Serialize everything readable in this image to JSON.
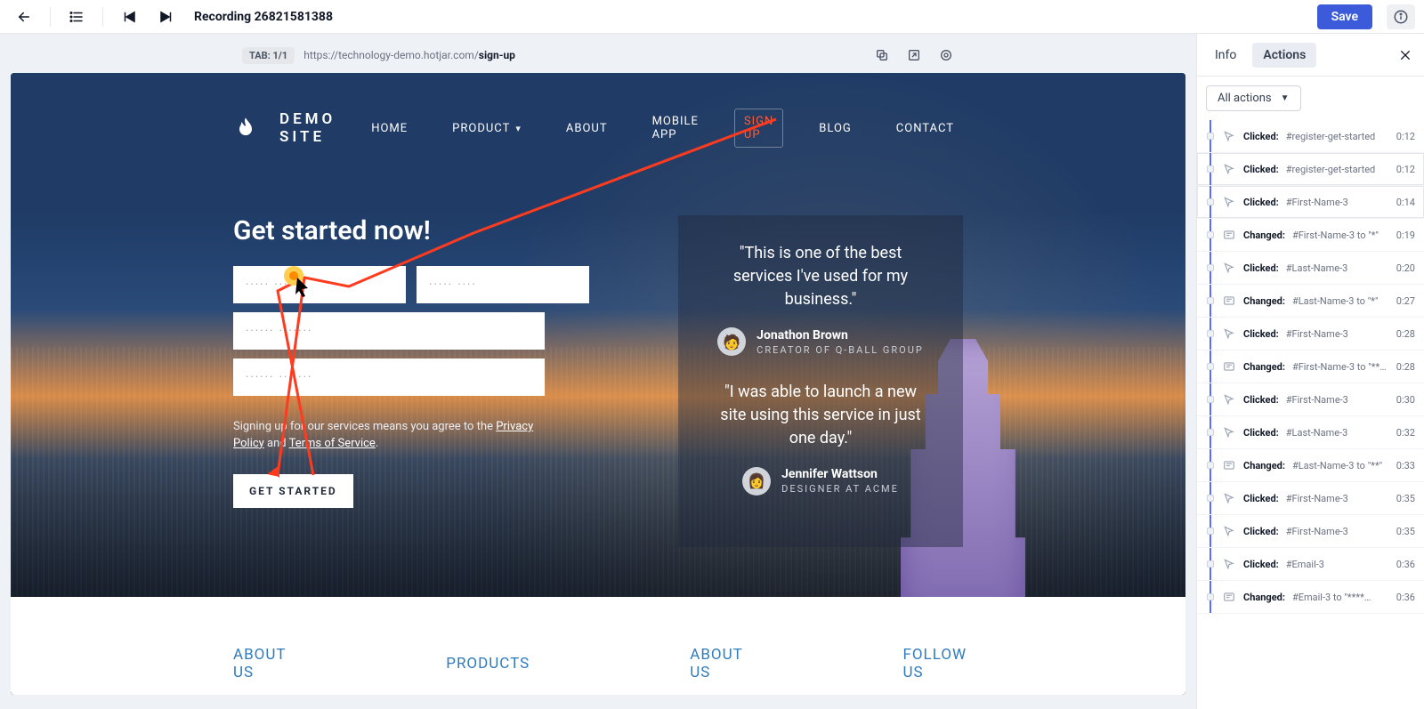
{
  "topbar": {
    "title": "Recording 26821581388",
    "save_label": "Save"
  },
  "urlbar": {
    "tab_pill": "TAB: 1/1",
    "url_dim": "https://technology-demo.hotjar.com/",
    "url_bold": "sign-up"
  },
  "site": {
    "brand": "DEMO SITE",
    "nav": {
      "home": "HOME",
      "product": "PRODUCT",
      "about": "ABOUT",
      "mobile": "MOBILE APP",
      "signup": "SIGN UP",
      "blog": "BLOG",
      "contact": "CONTACT"
    },
    "hero": {
      "headline": "Get started now!",
      "placeholders": {
        "first": "····· ····",
        "last": "····· ····",
        "email": "······ ·······",
        "password": "······ ·······"
      },
      "consent_prefix": "Signing up for our services means you agree to the ",
      "privacy": "Privacy Policy",
      "and": " and ",
      "tos": "Terms of Service",
      "period": ".",
      "cta": "GET STARTED"
    },
    "testimonials": [
      {
        "quote": "\"This is one of the best services I've used for my business.\"",
        "name": "Jonathon Brown",
        "role": "CREATOR OF Q-BALL GROUP"
      },
      {
        "quote": "\"I was able to launch a new site using this service in just one day.\"",
        "name": "Jennifer Wattson",
        "role": "DESIGNER AT ACME"
      }
    ],
    "footer": {
      "c1": "ABOUT US",
      "c2": "PRODUCTS",
      "c3": "ABOUT US",
      "c4": "FOLLOW US"
    }
  },
  "panel": {
    "tab_info": "Info",
    "tab_actions": "Actions",
    "filter_label": "All actions",
    "events": [
      {
        "type": "Clicked",
        "target": "#register-get-started",
        "ts": "0:12",
        "active": false
      },
      {
        "type": "Clicked",
        "target": "#register-get-started",
        "ts": "0:12",
        "active": true
      },
      {
        "type": "Clicked",
        "target": "#First-Name-3",
        "ts": "0:14",
        "active": true
      },
      {
        "type": "Changed",
        "target": "#First-Name-3&nbsp;to \"*\"",
        "ts": "0:19",
        "active": false
      },
      {
        "type": "Clicked",
        "target": "#Last-Name-3",
        "ts": "0:20",
        "active": false
      },
      {
        "type": "Changed",
        "target": "#Last-Name-3&nbsp;to \"*\"",
        "ts": "0:27",
        "active": false
      },
      {
        "type": "Clicked",
        "target": "#First-Name-3",
        "ts": "0:28",
        "active": false
      },
      {
        "type": "Changed",
        "target": "#First-Name-3&nbsp;to \"**…",
        "ts": "0:28",
        "active": false
      },
      {
        "type": "Clicked",
        "target": "#First-Name-3",
        "ts": "0:30",
        "active": false
      },
      {
        "type": "Clicked",
        "target": "#Last-Name-3",
        "ts": "0:32",
        "active": false
      },
      {
        "type": "Changed",
        "target": "#Last-Name-3&nbsp;to \"**\"",
        "ts": "0:33",
        "active": false
      },
      {
        "type": "Clicked",
        "target": "#First-Name-3",
        "ts": "0:35",
        "active": false
      },
      {
        "type": "Clicked",
        "target": "#First-Name-3",
        "ts": "0:35",
        "active": false
      },
      {
        "type": "Clicked",
        "target": "#Email-3",
        "ts": "0:36",
        "active": false
      },
      {
        "type": "Changed",
        "target": "#Email-3&nbsp;to \"****…",
        "ts": "0:36",
        "active": false
      }
    ]
  }
}
